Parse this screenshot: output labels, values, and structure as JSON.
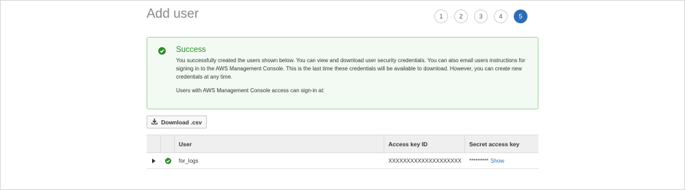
{
  "page": {
    "title": "Add user",
    "steps": [
      "1",
      "2",
      "3",
      "4",
      "5"
    ],
    "active_step": "5"
  },
  "alert": {
    "heading": "Success",
    "message": "You successfully created the users shown below. You can view and download user security credentials. You can also email users instructions for signing in to the AWS Management Console. This is the last time these credentials will be available to download. However, you can create new credentials at any time.",
    "signin_text": "Users with AWS Management Console access can sign-in at:",
    "icon": "check-circle-icon",
    "color": "#2e8b2e"
  },
  "toolbar": {
    "download_label": "Download .csv",
    "download_icon": "download-icon"
  },
  "table": {
    "headers": [
      "User",
      "Access key ID",
      "Secret access key"
    ],
    "rows": [
      {
        "user": "for_logs",
        "access_key_id": "XXXXXXXXXXXXXXXXXXXX",
        "secret_mask": "*********",
        "show_label": "Show"
      }
    ]
  },
  "colors": {
    "accent": "#2d6db5",
    "success": "#2e8b2e"
  }
}
